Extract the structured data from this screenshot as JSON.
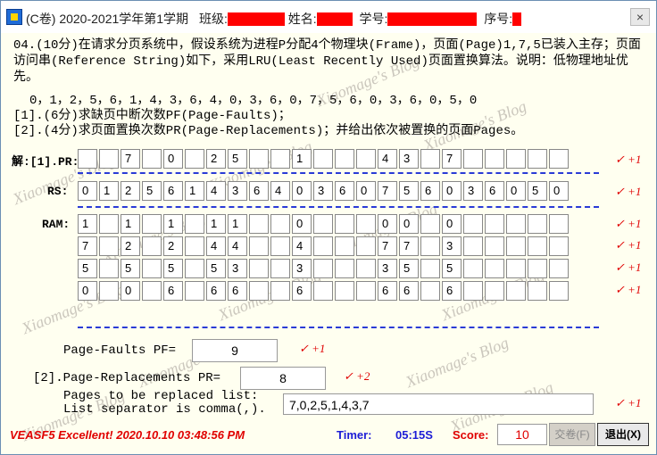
{
  "titlebar": {
    "exam_label": "(C卷) 2020-2021学年第1学期",
    "class_label": "班级:",
    "name_label": "姓名:",
    "id_label": "学号:",
    "seq_label": "序号:",
    "close_glyph": "×"
  },
  "question": {
    "text": "04.(10分)在请求分页系统中，假设系统为进程P分配4个物理块(Frame)，页面(Page)1,7,5已装入主存；页面访问串(Reference String)如下，采用LRU(Least Recently Used)页面置换算法。说明：低物理地址优先。",
    "sequence": "0，1，2，5，6，1，4，3，6，4，0，3，6，0，7，5，6，0，3，6，0，5，0",
    "sub1": "[1].(6分)求缺页中断次数PF(Page-Faults)；",
    "sub2": "[2].(4分)求页面置换次数PR(Page-Replacements)；并给出依次被置换的页面Pages。"
  },
  "answer": {
    "pr_label": "解:[1].PR:",
    "pr_row": [
      "",
      "",
      "7",
      "",
      "0",
      "",
      "2",
      "5",
      "",
      "",
      "1",
      "",
      "",
      "",
      "4",
      "3",
      "",
      "7",
      "",
      "",
      "",
      "",
      ""
    ],
    "rs_label": "RS:",
    "rs_row": [
      "0",
      "1",
      "2",
      "5",
      "6",
      "1",
      "4",
      "3",
      "6",
      "4",
      "0",
      "3",
      "6",
      "0",
      "7",
      "5",
      "6",
      "0",
      "3",
      "6",
      "0",
      "5",
      "0"
    ],
    "ram_label": "RAM:",
    "ram_rows": [
      [
        "1",
        "",
        "1",
        "",
        "1",
        "",
        "1",
        "1",
        "",
        "",
        "0",
        "",
        "",
        "",
        "0",
        "0",
        "",
        "0",
        "",
        "",
        "",
        "",
        ""
      ],
      [
        "7",
        "",
        "2",
        "",
        "2",
        "",
        "4",
        "4",
        "",
        "",
        "4",
        "",
        "",
        "",
        "7",
        "7",
        "",
        "3",
        "",
        "",
        "",
        "",
        ""
      ],
      [
        "5",
        "",
        "5",
        "",
        "5",
        "",
        "5",
        "3",
        "",
        "",
        "3",
        "",
        "",
        "",
        "3",
        "5",
        "",
        "5",
        "",
        "",
        "",
        "",
        ""
      ],
      [
        "0",
        "",
        "0",
        "",
        "6",
        "",
        "6",
        "6",
        "",
        "",
        "6",
        "",
        "",
        "",
        "6",
        "6",
        "",
        "6",
        "",
        "",
        "",
        "",
        ""
      ]
    ],
    "pf_label": "Page-Faults PF=",
    "pf_value": "9",
    "pr2_label": "[2].Page-Replacements PR=",
    "pr2_value": "8",
    "pages_label1": "Pages to be replaced list:",
    "pages_label2": "List separator is comma(,).",
    "pages_value": "7,0,2,5,1,4,3,7"
  },
  "marks": {
    "check_glyph": "✓",
    "plus1": "+1",
    "plus2": "+2"
  },
  "status": {
    "message": "VEASF5 Excellent! 2020.10.10 03:48:56 PM",
    "timer_label": "Timer:",
    "timer_value": "05:15S",
    "score_label": "Score:",
    "score_value": "10",
    "submit_label": "交卷(F)",
    "exit_label": "退出(X)"
  },
  "watermark": "Xiaomage's Blog",
  "colors": {
    "accent_red": "#e00000",
    "timer_blue": "#1d1dd6",
    "dash_blue": "#2a3bd6"
  }
}
